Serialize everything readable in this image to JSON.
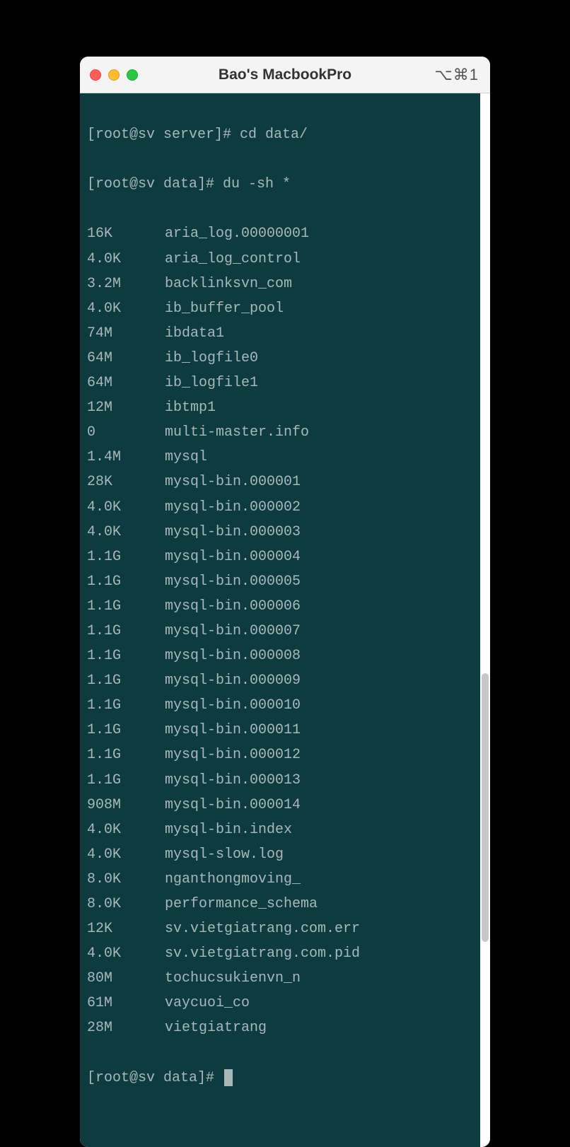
{
  "window": {
    "title": "Bao's MacbookPro",
    "shortcut": "⌥⌘1"
  },
  "terminal": {
    "prompt1": "[root@sv server]# cd data/",
    "prompt2": "[root@sv data]# du -sh *",
    "prompt3": "[root@sv data]# ",
    "rows": [
      {
        "size": "16K",
        "name": "aria_log.00000001"
      },
      {
        "size": "4.0K",
        "name": "aria_log_control"
      },
      {
        "size": "3.2M",
        "name": "backlinksvn_com"
      },
      {
        "size": "4.0K",
        "name": "ib_buffer_pool"
      },
      {
        "size": "74M",
        "name": "ibdata1"
      },
      {
        "size": "64M",
        "name": "ib_logfile0"
      },
      {
        "size": "64M",
        "name": "ib_logfile1"
      },
      {
        "size": "12M",
        "name": "ibtmp1"
      },
      {
        "size": "0",
        "name": "multi-master.info"
      },
      {
        "size": "1.4M",
        "name": "mysql"
      },
      {
        "size": "28K",
        "name": "mysql-bin.000001"
      },
      {
        "size": "4.0K",
        "name": "mysql-bin.000002"
      },
      {
        "size": "4.0K",
        "name": "mysql-bin.000003"
      },
      {
        "size": "1.1G",
        "name": "mysql-bin.000004"
      },
      {
        "size": "1.1G",
        "name": "mysql-bin.000005"
      },
      {
        "size": "1.1G",
        "name": "mysql-bin.000006"
      },
      {
        "size": "1.1G",
        "name": "mysql-bin.000007"
      },
      {
        "size": "1.1G",
        "name": "mysql-bin.000008"
      },
      {
        "size": "1.1G",
        "name": "mysql-bin.000009"
      },
      {
        "size": "1.1G",
        "name": "mysql-bin.000010"
      },
      {
        "size": "1.1G",
        "name": "mysql-bin.000011"
      },
      {
        "size": "1.1G",
        "name": "mysql-bin.000012"
      },
      {
        "size": "1.1G",
        "name": "mysql-bin.000013"
      },
      {
        "size": "908M",
        "name": "mysql-bin.000014"
      },
      {
        "size": "4.0K",
        "name": "mysql-bin.index"
      },
      {
        "size": "4.0K",
        "name": "mysql-slow.log"
      },
      {
        "size": "8.0K",
        "name": "nganthongmoving_"
      },
      {
        "size": "8.0K",
        "name": "performance_schema"
      },
      {
        "size": "12K",
        "name": "sv.vietgiatrang.com.err"
      },
      {
        "size": "4.0K",
        "name": "sv.vietgiatrang.com.pid"
      },
      {
        "size": "80M",
        "name": "tochucsukienvn_n"
      },
      {
        "size": "61M",
        "name": "vaycuoi_co"
      },
      {
        "size": "28M",
        "name": "vietgiatrang"
      }
    ]
  }
}
